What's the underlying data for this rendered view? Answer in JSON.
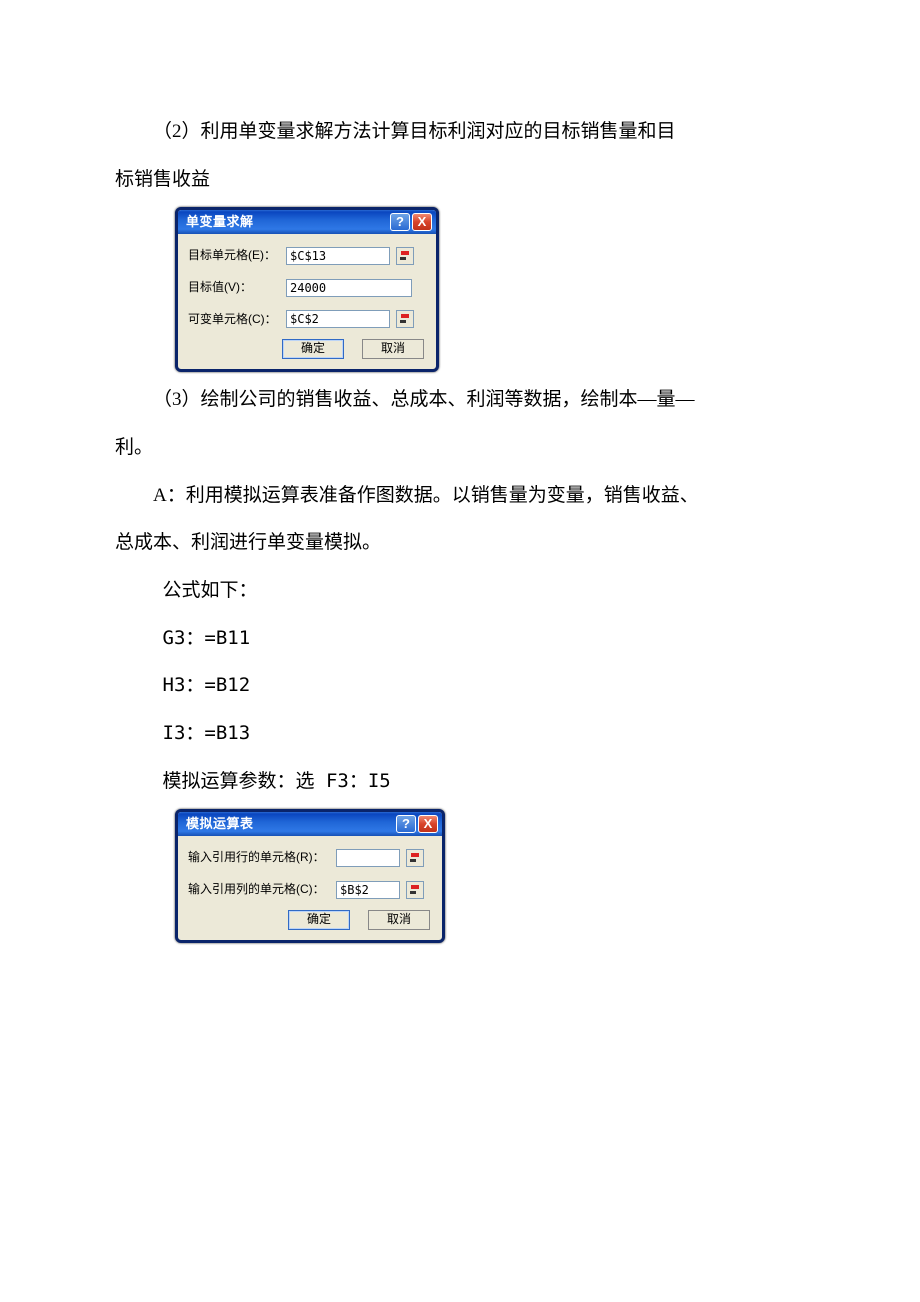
{
  "text": {
    "p1a": "（2）利用单变量求解方法计算目标利润对应的目标销售量和目",
    "p1b": "标销售收益",
    "p2a": "（3）绘制公司的销售收益、总成本、利润等数据，绘制本—量—",
    "p2b": "利。",
    "p3a": "A：利用模拟运算表准备作图数据。以销售量为变量，销售收益、",
    "p3b": "总成本、利润进行单变量模拟。",
    "p4": "公式如下：",
    "f1": "G3：=B11",
    "f2": "H3：=B12",
    "f3": "I3：=B13",
    "p5": "模拟运算参数：选 F3：I5"
  },
  "dialog1": {
    "title": "单变量求解",
    "label_target_cell": "目标单元格(E)：",
    "value_target_cell": "$C$13",
    "label_target_value": "目标值(V)：",
    "value_target_value": "24000",
    "label_changing_cell": "可变单元格(C)：",
    "value_changing_cell": "$C$2",
    "ok": "确定",
    "cancel": "取消",
    "help": "?",
    "close": "X"
  },
  "dialog2": {
    "title": "模拟运算表",
    "label_row_input": "输入引用行的单元格(R)：",
    "value_row_input": "",
    "label_col_input": "输入引用列的单元格(C)：",
    "value_col_input": "$B$2",
    "ok": "确定",
    "cancel": "取消",
    "help": "?",
    "close": "X"
  }
}
